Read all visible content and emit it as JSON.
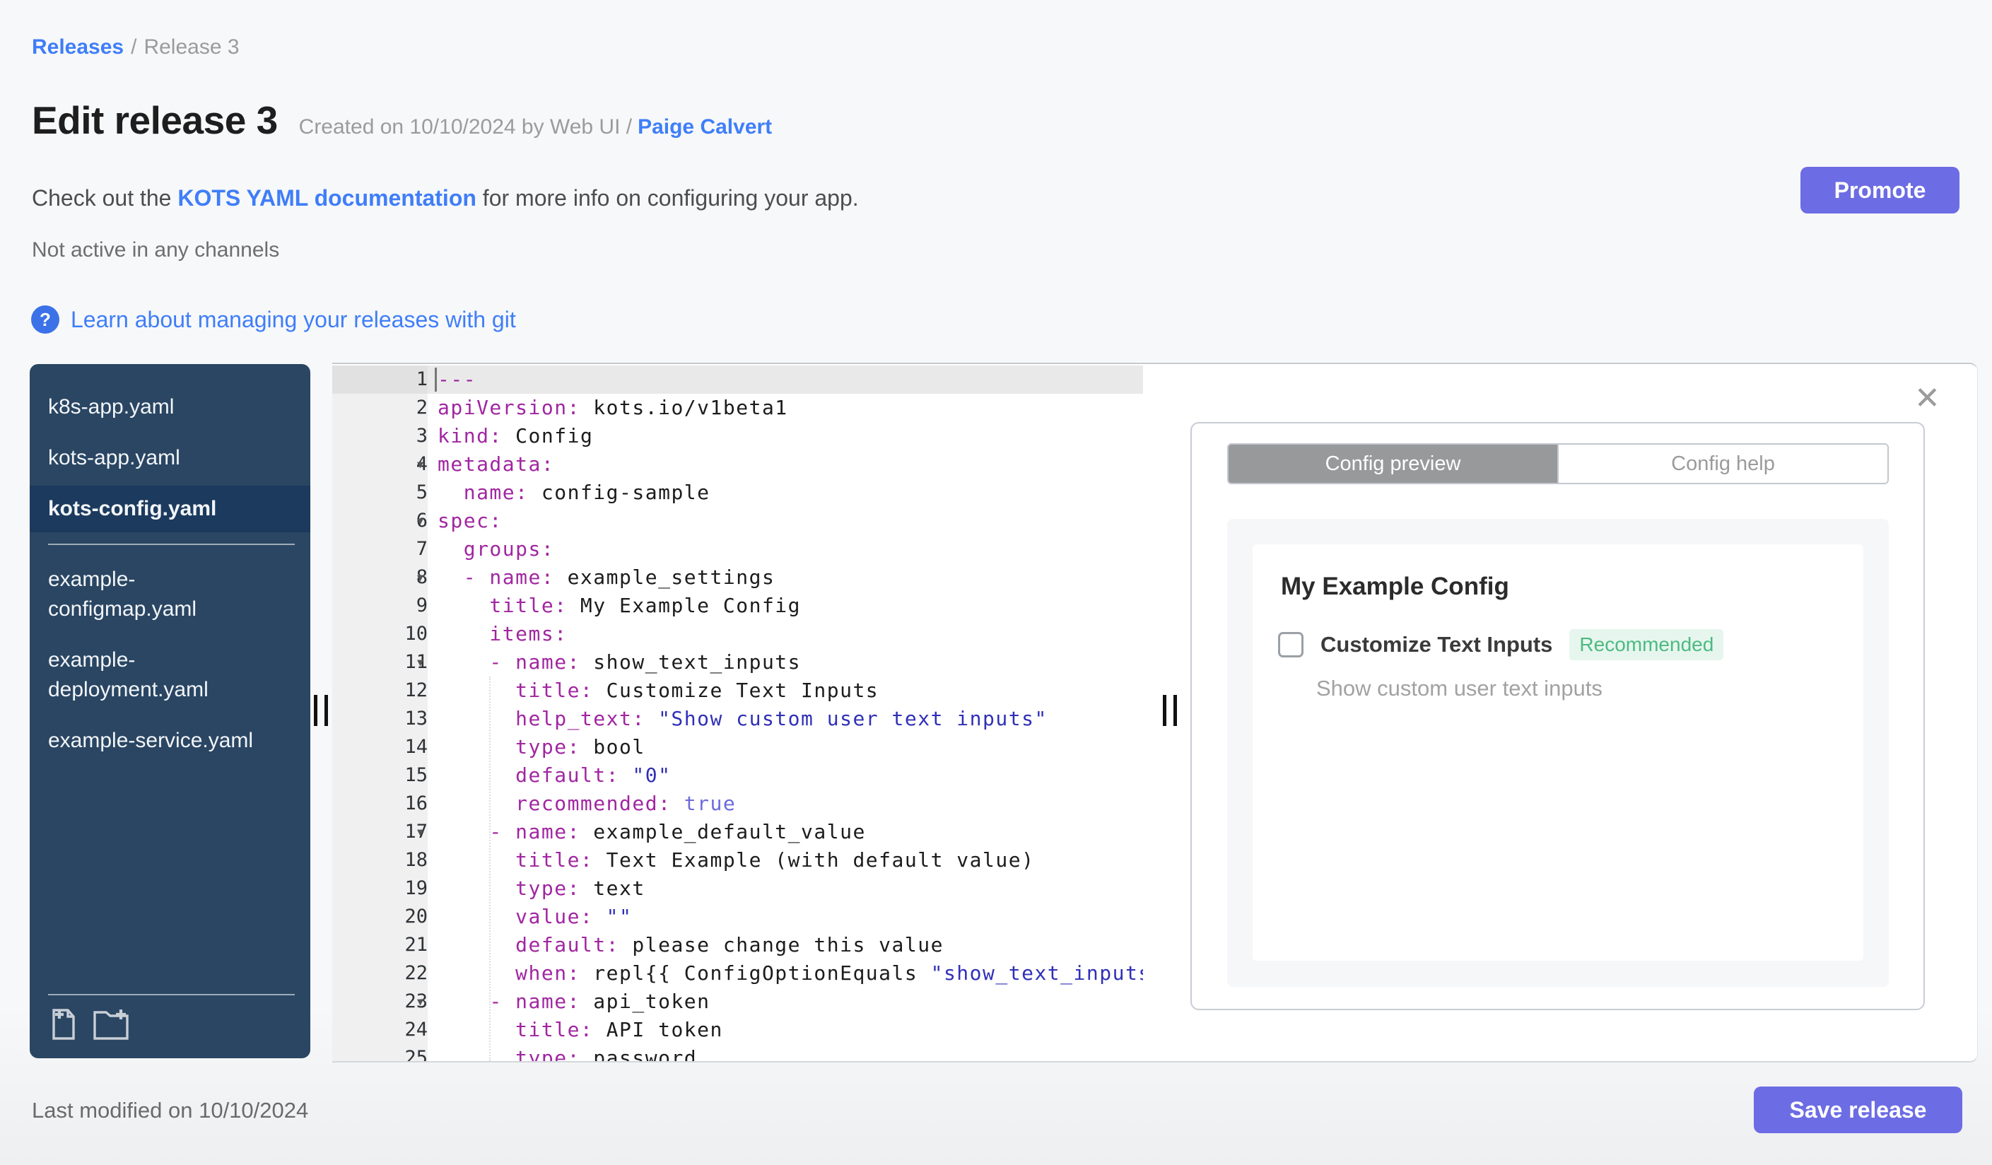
{
  "colors": {
    "link_blue": "#3f7ef8",
    "accent_indigo": "#6c6ce4",
    "sidebar_navy": "#2a4663",
    "sidebar_selected": "#1c3a5e",
    "yaml_key": "#a126a1",
    "yaml_string": "#3030b8",
    "yaml_bool": "#6b6bdd",
    "badge_green_bg": "#e6f6ee",
    "badge_green_text": "#4eba81"
  },
  "breadcrumb": {
    "link": "Releases",
    "separator": "/",
    "current": "Release 3"
  },
  "header": {
    "title": "Edit release 3",
    "created_prefix": "Created on 10/10/2024 by Web UI /",
    "created_author": "Paige Calvert",
    "doc_text_before": "Check out the ",
    "doc_link": "KOTS YAML documentation",
    "doc_text_after": " for more info on configuring your app.",
    "channel_status": "Not active in any channels",
    "help_icon": "?",
    "git_link": "Learn about managing your releases with git",
    "promote_label": "Promote"
  },
  "sidebar": {
    "files": [
      {
        "label": "k8s-app.yaml",
        "selected": false
      },
      {
        "label": "kots-app.yaml",
        "selected": false
      },
      {
        "label": "kots-config.yaml",
        "selected": true
      },
      {
        "divider": true
      },
      {
        "label": "example-configmap.yaml",
        "selected": false
      },
      {
        "label": "example-deployment.yaml",
        "selected": false
      },
      {
        "label": "example-service.yaml",
        "selected": false
      }
    ],
    "add_file_icon": "add-file",
    "add_folder_icon": "add-folder"
  },
  "editor": {
    "lines": [
      {
        "n": 1,
        "active": true,
        "cursor": true,
        "seg": [
          {
            "t": "---",
            "c": "k"
          }
        ]
      },
      {
        "n": 2,
        "seg": [
          {
            "t": "apiVersion:",
            "c": "k"
          },
          {
            "t": " kots.io/v1beta1",
            "c": "v"
          }
        ]
      },
      {
        "n": 3,
        "seg": [
          {
            "t": "kind:",
            "c": "k"
          },
          {
            "t": " Config",
            "c": "v"
          }
        ]
      },
      {
        "n": 4,
        "fold": true,
        "seg": [
          {
            "t": "metadata:",
            "c": "k"
          }
        ]
      },
      {
        "n": 5,
        "seg": [
          {
            "t": "  name:",
            "c": "k"
          },
          {
            "t": " config-sample",
            "c": "v"
          }
        ]
      },
      {
        "n": 6,
        "fold": true,
        "seg": [
          {
            "t": "spec:",
            "c": "k"
          }
        ]
      },
      {
        "n": 7,
        "seg": [
          {
            "t": "  groups:",
            "c": "k"
          }
        ]
      },
      {
        "n": 8,
        "fold": true,
        "seg": [
          {
            "t": "  - name:",
            "c": "k"
          },
          {
            "t": " example_settings",
            "c": "v"
          }
        ]
      },
      {
        "n": 9,
        "seg": [
          {
            "t": "    title:",
            "c": "k"
          },
          {
            "t": " My Example Config",
            "c": "v"
          }
        ]
      },
      {
        "n": 10,
        "seg": [
          {
            "t": "    items:",
            "c": "k"
          }
        ]
      },
      {
        "n": 11,
        "fold": true,
        "seg": [
          {
            "t": "    - name:",
            "c": "k"
          },
          {
            "t": " show_text_inputs",
            "c": "v"
          }
        ]
      },
      {
        "n": 12,
        "seg": [
          {
            "t": "      title:",
            "c": "k"
          },
          {
            "t": " Customize Text Inputs",
            "c": "v"
          }
        ]
      },
      {
        "n": 13,
        "seg": [
          {
            "t": "      help_text:",
            "c": "k"
          },
          {
            "t": " ",
            "c": "v"
          },
          {
            "t": "\"Show custom user text inputs\"",
            "c": "s"
          }
        ]
      },
      {
        "n": 14,
        "seg": [
          {
            "t": "      type:",
            "c": "k"
          },
          {
            "t": " bool",
            "c": "v"
          }
        ]
      },
      {
        "n": 15,
        "seg": [
          {
            "t": "      default:",
            "c": "k"
          },
          {
            "t": " ",
            "c": "v"
          },
          {
            "t": "\"0\"",
            "c": "s"
          }
        ]
      },
      {
        "n": 16,
        "seg": [
          {
            "t": "      recommended:",
            "c": "k"
          },
          {
            "t": " ",
            "c": "v"
          },
          {
            "t": "true",
            "c": "b"
          }
        ]
      },
      {
        "n": 17,
        "fold": true,
        "seg": [
          {
            "t": "    - name:",
            "c": "k"
          },
          {
            "t": " example_default_value",
            "c": "v"
          }
        ]
      },
      {
        "n": 18,
        "seg": [
          {
            "t": "      title:",
            "c": "k"
          },
          {
            "t": " Text Example (with default value)",
            "c": "v"
          }
        ]
      },
      {
        "n": 19,
        "seg": [
          {
            "t": "      type:",
            "c": "k"
          },
          {
            "t": " text",
            "c": "v"
          }
        ]
      },
      {
        "n": 20,
        "seg": [
          {
            "t": "      value:",
            "c": "k"
          },
          {
            "t": " ",
            "c": "v"
          },
          {
            "t": "\"\"",
            "c": "s"
          }
        ]
      },
      {
        "n": 21,
        "seg": [
          {
            "t": "      default:",
            "c": "k"
          },
          {
            "t": " please change this value",
            "c": "v"
          }
        ]
      },
      {
        "n": 22,
        "seg": [
          {
            "t": "      when:",
            "c": "k"
          },
          {
            "t": " repl{{ ConfigOptionEquals ",
            "c": "v"
          },
          {
            "t": "\"show_text_inputs\"",
            "c": "s"
          }
        ]
      },
      {
        "n": 23,
        "fold": true,
        "seg": [
          {
            "t": "    - name:",
            "c": "k"
          },
          {
            "t": " api_token",
            "c": "v"
          }
        ]
      },
      {
        "n": 24,
        "seg": [
          {
            "t": "      title:",
            "c": "k"
          },
          {
            "t": " API token",
            "c": "v"
          }
        ]
      },
      {
        "n": 25,
        "seg": [
          {
            "t": "      type:",
            "c": "k"
          },
          {
            "t": " password",
            "c": "v"
          }
        ]
      }
    ]
  },
  "preview": {
    "close_icon": "✕",
    "tabs": [
      {
        "label": "Config preview",
        "active": true
      },
      {
        "label": "Config help",
        "active": false
      }
    ],
    "group_title": "My Example Config",
    "item": {
      "label": "Customize Text Inputs",
      "badge": "Recommended",
      "help": "Show custom user text inputs",
      "checked": false
    }
  },
  "footer": {
    "last_modified": "Last modified on 10/10/2024",
    "save_label": "Save release"
  }
}
